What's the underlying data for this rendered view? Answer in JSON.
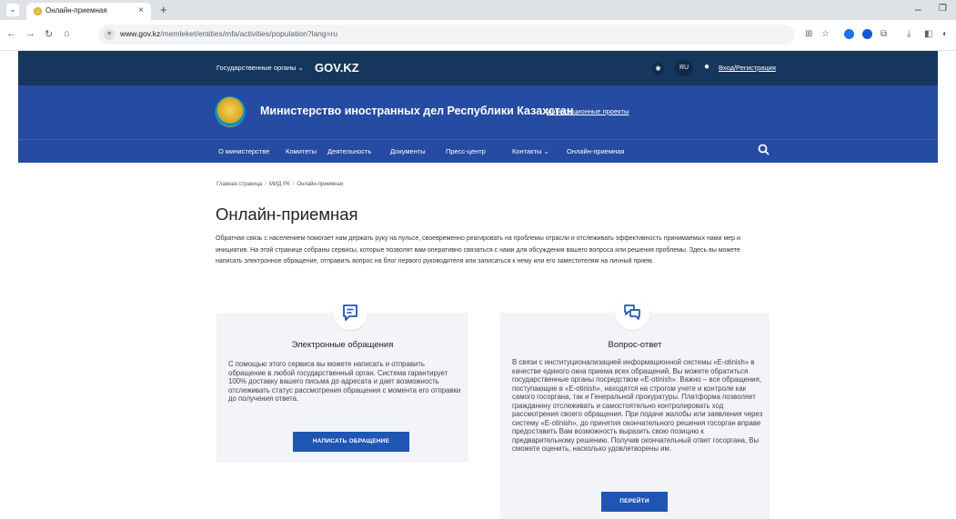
{
  "browser": {
    "tab_title": "Онлайн-приемная",
    "url_domain": "www.gov.kz",
    "url_path": "/memleket/entities/mfa/activities/population?lang=ru"
  },
  "topbar": {
    "gov_agencies": "Государственные органы",
    "brand": "GOV.KZ",
    "lang": "RU",
    "login": "Вход/Регистрация"
  },
  "header": {
    "ministry_name": "Министерство иностранных дел Республики Казахстан",
    "invest_link": "Инвестиционные проекты"
  },
  "nav": {
    "items": [
      "О министерстве",
      "Комитеты",
      "Деятельность",
      "Документы",
      "Пресс-центр",
      "Контакты",
      "Онлайн-приемная"
    ]
  },
  "breadcrumb": {
    "items": [
      "Главная страница",
      "МИД РК",
      "Онлайн-приемная"
    ]
  },
  "page": {
    "title": "Онлайн-приемная",
    "intro": "Обратная связь с населением помогает нам держать руку на пульсе, своевременно реагировать на проблемы отрасли и отслеживать эффективность принимаемых нами мер и инициатив. На этой странице собраны сервисы, которые позволят вам оперативно связаться с нами для обсуждения вашего вопроса или решения проблемы. Здесь вы можете написать электронное обращение, отправить вопрос на блог первого руководителя или записаться к нему или его заместителям на личный прием."
  },
  "cards": [
    {
      "title": "Электронные обращения",
      "text": "С помощью этого сервиса вы можете написать и отправить обращение в любой государственный орган. Система гарантирует 100% доставку вашего письма до адресата и дает возможность отслеживать статус рассмотрения обращения с момента его отправки до получения ответа.",
      "button": "НАПИСАТЬ ОБРАЩЕНИЕ",
      "icon": "message-icon"
    },
    {
      "title": "Вопрос-ответ",
      "text": "В связи с институционализацией информационной системы «E-otinish» в качестве единого окна приема всех обращений, Вы можете обратиться государственные органы посредством «E-otinish». Важно – все обращения, поступающие в «E-otinish», находятся на строгом учете и контроле как самого госоргана, так и Генеральной прокуратуры. Платформа позволяет гражданину отслеживать и самостоятельно контролировать ход рассмотрения своего обращения. При подаче жалобы или заявления через систему «E-otinish», до принятия окончательного решения госорган вправе предоставить Вам возможность выразить свою позицию к предварительному решению. Получив окончательный ответ госоргана, Вы сможете оценить, насколько удовлетворены им.",
      "button": "ПЕРЕЙТИ",
      "icon": "chat-icon"
    }
  ],
  "colors": {
    "topbar": "#17365d",
    "header": "#264ba2",
    "button": "#1f55b3",
    "card_bg": "#f3f4f7"
  }
}
